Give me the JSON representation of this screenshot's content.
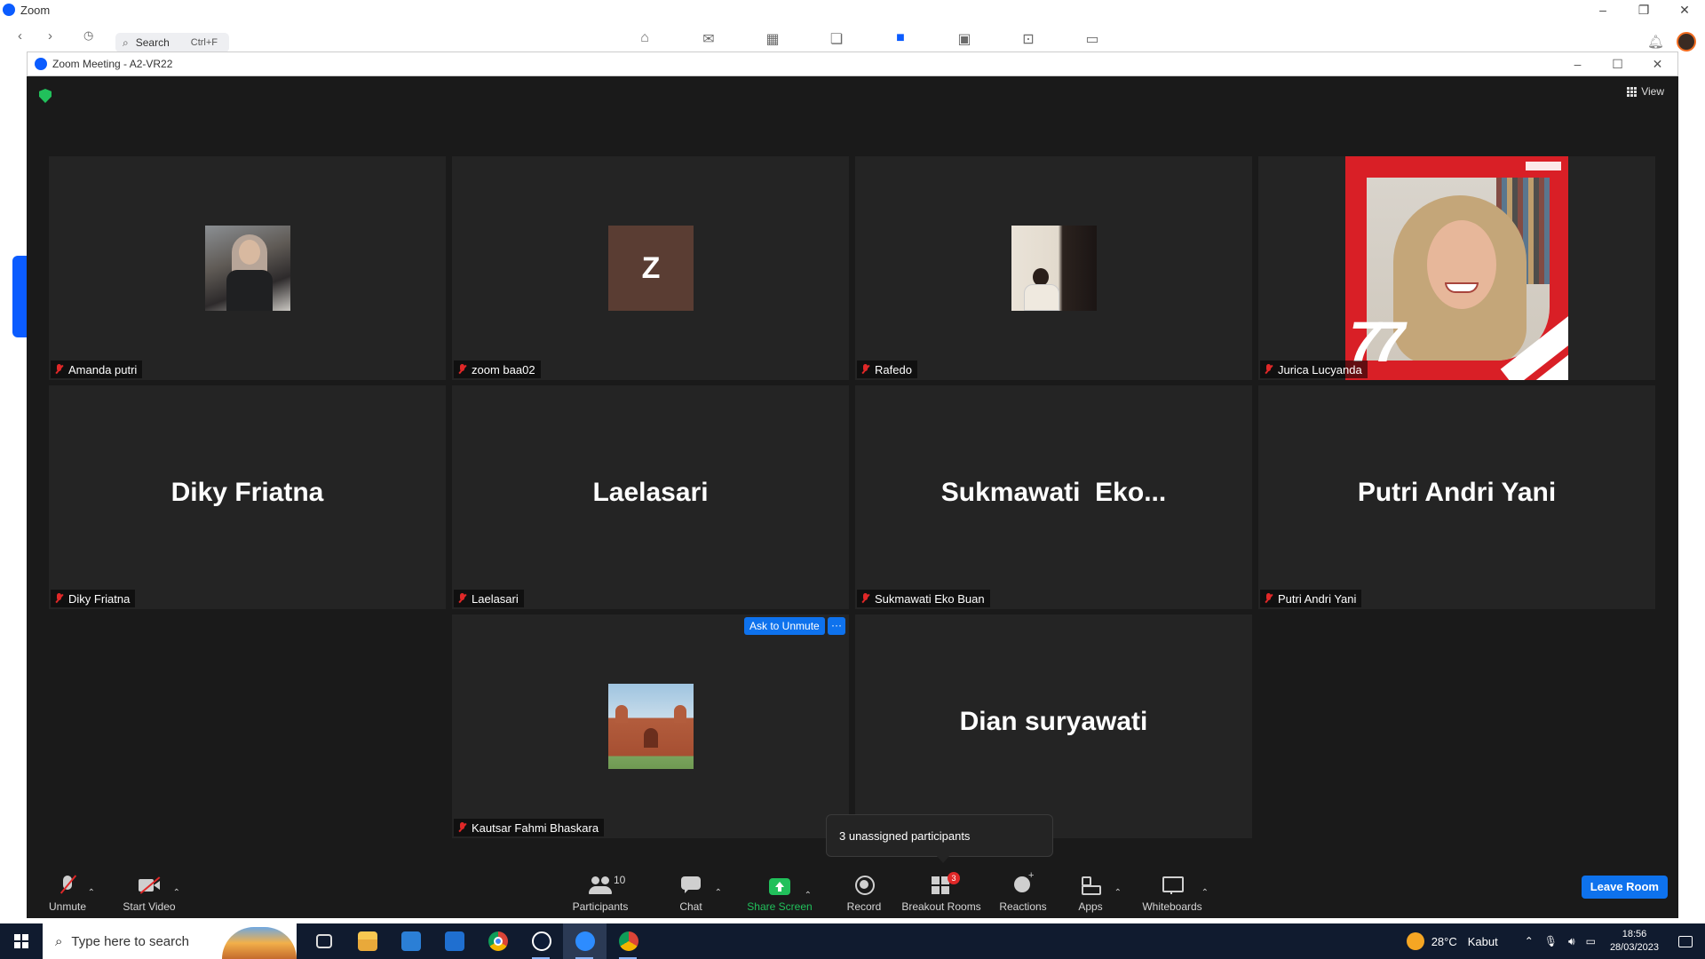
{
  "app": {
    "title": "Zoom",
    "window_controls": [
      "–",
      "❐",
      "✕"
    ],
    "nav_back": "‹",
    "nav_forward": "›",
    "search_label": "Search",
    "search_shortcut": "Ctrl+F"
  },
  "meeting": {
    "window_title": "Zoom Meeting - A2-VR22",
    "view_label": "View",
    "ask_to_unmute_label": "Ask to Unmute",
    "more_label": "···",
    "unassigned_tooltip": "3 unassigned participants",
    "leave_label": "Leave Room",
    "participant_count": "10",
    "breakout_badge": "3",
    "tiles": [
      {
        "display": "photo",
        "name": "Amanda putri"
      },
      {
        "display": "initial",
        "initial": "Z",
        "name": "zoom baa02"
      },
      {
        "display": "photo",
        "name": "Rafedo"
      },
      {
        "display": "photo",
        "name": "Jurica Lucyanda"
      },
      {
        "display": "name",
        "big_name": "Diky Friatna",
        "name": "Diky Friatna"
      },
      {
        "display": "name",
        "big_name": "Laelasari",
        "name": "Laelasari"
      },
      {
        "display": "name",
        "big_name": "Sukmawati  Eko...",
        "name": "Sukmawati Eko Buan"
      },
      {
        "display": "name",
        "big_name": "Putri Andri Yani",
        "name": "Putri Andri Yani"
      },
      {
        "display": "photo",
        "name": "Kautsar Fahmi Bhaskara"
      },
      {
        "display": "name",
        "big_name": "Dian suryawati"
      }
    ]
  },
  "toolbar": {
    "unmute": "Unmute",
    "start_video": "Start Video",
    "participants": "Participants",
    "chat": "Chat",
    "share_screen": "Share Screen",
    "record": "Record",
    "breakout_rooms": "Breakout Rooms",
    "reactions": "Reactions",
    "apps": "Apps",
    "whiteboards": "Whiteboards"
  },
  "taskbar": {
    "search_placeholder": "Type here to search",
    "temperature": "28°C",
    "weather": "Kabut",
    "time": "18:56",
    "date": "28/03/2023"
  },
  "colors": {
    "meeting_bg": "#1a1a1a",
    "tile_bg": "#242424",
    "accent_blue": "#0e72ed",
    "share_green": "#21c05b",
    "muted_red": "#e02828",
    "taskbar_bg": "#101b2f"
  }
}
